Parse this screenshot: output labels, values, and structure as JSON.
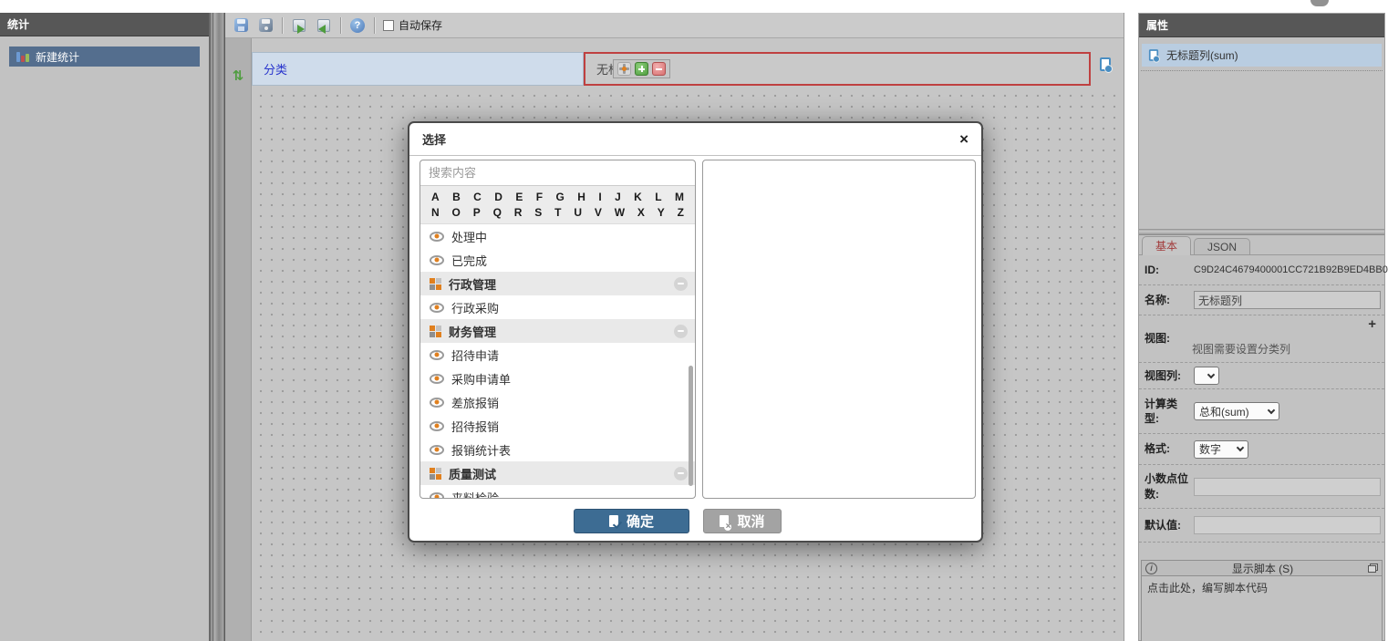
{
  "app": {
    "autosave_label": "自动保存"
  },
  "left_sidebar": {
    "title": "统计",
    "items": [
      {
        "label": "新建统计",
        "icon": "bar-chart-icon",
        "selected": true
      }
    ]
  },
  "toolbar_icons": [
    "save-icon",
    "save-dark-icon",
    "export-icon",
    "import-icon",
    "help-icon"
  ],
  "designer": {
    "swap_glyph": "⇅",
    "mini_toolbar_icons": [
      "move-icon",
      "add-column-icon",
      "remove-column-icon"
    ],
    "category_header": "分类",
    "column_header": "无标题列",
    "add_column_icon": "document-add-icon",
    "column_selected_border": "#bf4040",
    "category_text_color": "#2733cc"
  },
  "dialog": {
    "title": "选择",
    "close_label": "×",
    "search_placeholder": "搜索内容",
    "alphabet_row1": [
      "A",
      "B",
      "C",
      "D",
      "E",
      "F",
      "G",
      "H",
      "I",
      "J",
      "K",
      "L",
      "M"
    ],
    "alphabet_row2": [
      "N",
      "O",
      "P",
      "Q",
      "R",
      "S",
      "T",
      "U",
      "V",
      "W",
      "X",
      "Y",
      "Z"
    ],
    "items": [
      {
        "label": "处理中",
        "type": "view"
      },
      {
        "label": "已完成",
        "type": "view"
      },
      {
        "label": "行政管理",
        "type": "group"
      },
      {
        "label": "行政采购",
        "type": "view"
      },
      {
        "label": "财务管理",
        "type": "group"
      },
      {
        "label": "招待申请",
        "type": "view"
      },
      {
        "label": "采购申请单",
        "type": "view"
      },
      {
        "label": "差旅报销",
        "type": "view"
      },
      {
        "label": "招待报销",
        "type": "view"
      },
      {
        "label": "报销统计表",
        "type": "view"
      },
      {
        "label": "质量测试",
        "type": "group"
      },
      {
        "label": "来料检验",
        "type": "view"
      }
    ],
    "ok_label": "确定",
    "cancel_label": "取消",
    "ok_color": "#3d6c93",
    "cancel_color": "#a3a3a3"
  },
  "properties": {
    "title": "属性",
    "selected_item": "无标题列(sum)",
    "selected_item_bg": "#b9cde1",
    "tabs": [
      {
        "label": "基本",
        "active": true
      },
      {
        "label": "JSON",
        "active": false
      }
    ],
    "fields": {
      "id_label": "ID:",
      "id_value": "C9D24C4679400001CC721B92B9ED4BB0",
      "name_label": "名称:",
      "name_value": "无标题列",
      "view_label": "视图:",
      "view_add": "+",
      "view_hint": "视图需要设置分类列",
      "view_column_label": "视图列:",
      "calc_type_label": "计算类型:",
      "calc_type_value": "总和(sum)",
      "format_label": "格式:",
      "format_value": "数字",
      "decimal_label": "小数点位数:",
      "default_label": "默认值:",
      "script_header": "显示脚本 (S)",
      "script_hint": "点击此处，编写脚本代码"
    }
  }
}
